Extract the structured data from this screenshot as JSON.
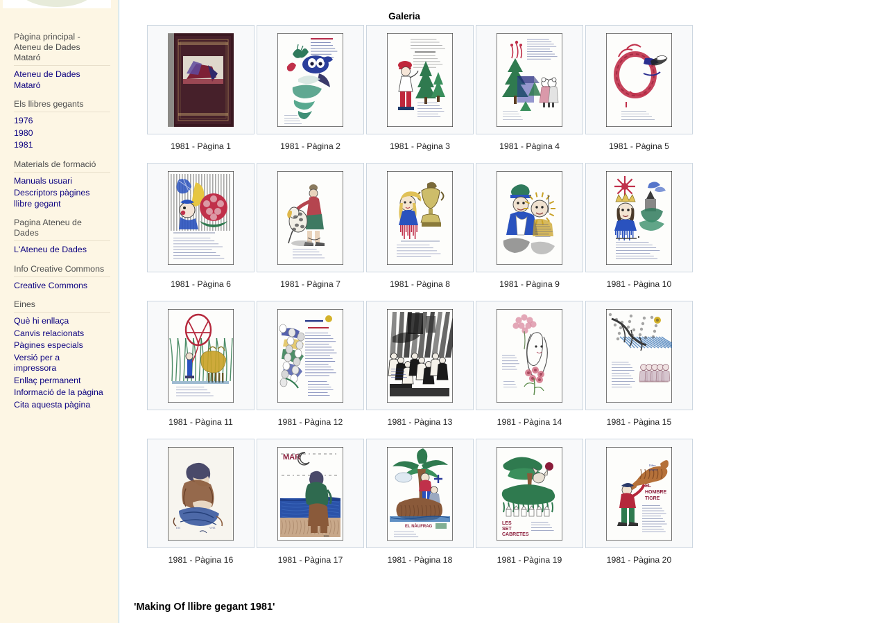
{
  "sidebar": {
    "logo": {
      "icon": "wiki-logo-ellipse"
    },
    "portlets": [
      {
        "heading": "Pàgina principal -\nAteneu de Dades\nMataró",
        "links": [
          "Ateneu de Dades\nMataró"
        ]
      },
      {
        "heading": "Els llibres gegants",
        "links": [
          "1976",
          "1980",
          "1981"
        ]
      },
      {
        "heading": "Materials de formació",
        "links": [
          "Manuals usuari",
          "Descriptors pàgines\nllibre gegant"
        ]
      },
      {
        "heading": "Pagina Ateneu de\nDades",
        "links": [
          "L'Ateneu de Dades"
        ]
      },
      {
        "heading": "Info Creative Commons",
        "links": [
          "Creative Commons"
        ]
      },
      {
        "heading": "Eines",
        "links": [
          "Què hi enllaça",
          "Canvis relacionats",
          "Pàgines especials",
          "Versió per a\nimpressora",
          "Enllaç permanent",
          "Informació de la pàgina",
          "Cita aquesta pàgina"
        ]
      }
    ]
  },
  "content": {
    "gallery_title": "Galeria",
    "making_of_heading": "'Making Of llibre gegant 1981'",
    "gallery": {
      "columns": 5,
      "items": [
        {
          "caption": "1981 - Pàgina 1",
          "art": "book-cover"
        },
        {
          "caption": "1981 - Pàgina 2",
          "art": "mermaid"
        },
        {
          "caption": "1981 - Pàgina 3",
          "art": "boy-trees"
        },
        {
          "caption": "1981 - Pàgina 4",
          "art": "pines-mice"
        },
        {
          "caption": "1981 - Pàgina 5",
          "art": "red-wreath"
        },
        {
          "caption": "1981 - Pàgina 6",
          "art": "moon-clown"
        },
        {
          "caption": "1981 - Pàgina 7",
          "art": "woman-dog"
        },
        {
          "caption": "1981 - Pàgina 8",
          "art": "girl-trophy"
        },
        {
          "caption": "1981 - Pàgina 9",
          "art": "two-heads"
        },
        {
          "caption": "1981 - Pàgina 10",
          "art": "king-castle"
        },
        {
          "caption": "1981 - Pàgina 11",
          "art": "balloon-beast"
        },
        {
          "caption": "1981 - Pàgina 12",
          "art": "collage-text"
        },
        {
          "caption": "1981 - Pàgina 13",
          "art": "crowd-bw"
        },
        {
          "caption": "1981 - Pàgina 14",
          "art": "girl-flowers"
        },
        {
          "caption": "1981 - Pàgina 15",
          "art": "tree-blue"
        },
        {
          "caption": "1981 - Pàgina 16",
          "art": "seated-reader"
        },
        {
          "caption": "1981 - Pàgina 17",
          "art": "sea-night"
        },
        {
          "caption": "1981 - Pàgina 18",
          "art": "palm-island"
        },
        {
          "caption": "1981 - Pàgina 19",
          "art": "tree-dog"
        },
        {
          "caption": "1981 - Pàgina 20",
          "art": "tiger-man"
        }
      ]
    }
  },
  "colors": {
    "sidebar_bg": "#fdf6e4",
    "sidebar_border": "#a7d7f9",
    "link": "#0b0080",
    "heading_gray": "#4d4d4d",
    "thumb_border": "#ccd6e0",
    "thumb_bg": "#f8f9fa"
  }
}
